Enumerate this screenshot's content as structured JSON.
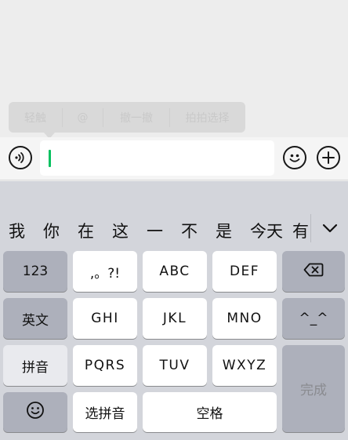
{
  "popup_menu": {
    "items": [
      "轻触",
      "@",
      "撤一撤",
      "拍拍选择"
    ]
  },
  "input_bar": {
    "voice_icon": "voice-wave-icon",
    "emoji_icon": "smiley-icon",
    "plus_icon": "plus-icon",
    "text_value": ""
  },
  "keyboard": {
    "candidates": [
      "我",
      "你",
      "在",
      "这",
      "一",
      "不",
      "是",
      "今天",
      "有"
    ],
    "expand_icon": "chevron-down-icon",
    "keys": {
      "num": "123",
      "punct": ",。?!",
      "abc": "ABC",
      "def": "DEF",
      "delete_icon": "backspace-icon",
      "english": "英文",
      "ghi": "GHI",
      "jkl": "JKL",
      "mno": "MNO",
      "kaomoji": "^_^",
      "pinyin": "拼音",
      "pqrs": "PQRS",
      "tuv": "TUV",
      "wxyz": "WXYZ",
      "done": "完成",
      "emoji_icon": "smiley-icon",
      "select_pinyin": "选拼音",
      "space": "空格"
    }
  }
}
